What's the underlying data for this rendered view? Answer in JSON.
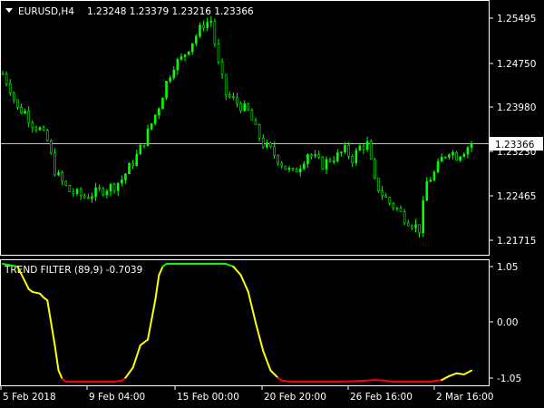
{
  "header": {
    "symbol_label": "EURUSD,H4",
    "ohlc": "1.23248 1.23379 1.23216 1.23366"
  },
  "price_axis": {
    "ticks": [
      "1.25495",
      "1.24750",
      "1.23980",
      "1.23230",
      "1.22465",
      "1.21715"
    ],
    "current_price_label": "1.23366"
  },
  "indicator": {
    "label": "TREND FILTER (89,9) -0.7039",
    "ticks": [
      "1.05",
      "0.00",
      "-1.05"
    ]
  },
  "time_axis": {
    "labels": [
      "5 Feb 2018",
      "9 Feb 04:00",
      "15 Feb 00:00",
      "20 Feb 20:00",
      "26 Feb 16:00",
      "2 Mar 16:00"
    ]
  },
  "colors": {
    "background": "#000000",
    "up_candle": "#00ff00",
    "grid_line": "#c0c0c0",
    "indicator_up": "#00ff00",
    "indicator_neutral": "#ffff00",
    "indicator_down": "#ff0000"
  },
  "chart_data": [
    {
      "type": "candlestick",
      "title": "EURUSD,H4",
      "price_ticks": [
        1.25495,
        1.2475,
        1.2398,
        1.2323,
        1.22465,
        1.21715
      ],
      "current_price": 1.23366,
      "close_path": [
        [
          0,
          1.2455
        ],
        [
          4,
          1.243
        ],
        [
          8,
          1.2395
        ],
        [
          12,
          1.239
        ],
        [
          16,
          1.237
        ],
        [
          20,
          1.236
        ],
        [
          24,
          1.234
        ],
        [
          28,
          1.229
        ],
        [
          32,
          1.227
        ],
        [
          36,
          1.2255
        ],
        [
          40,
          1.225
        ],
        [
          44,
          1.2245
        ],
        [
          48,
          1.225
        ],
        [
          52,
          1.2255
        ],
        [
          56,
          1.226
        ],
        [
          60,
          1.2265
        ],
        [
          64,
          1.2275
        ],
        [
          68,
          1.2295
        ],
        [
          72,
          1.2315
        ],
        [
          76,
          1.234
        ],
        [
          80,
          1.237
        ],
        [
          84,
          1.24
        ],
        [
          88,
          1.244
        ],
        [
          92,
          1.247
        ],
        [
          96,
          1.248
        ],
        [
          100,
          1.25
        ],
        [
          104,
          1.252
        ],
        [
          108,
          1.254
        ],
        [
          112,
          1.2545
        ],
        [
          116,
          1.247
        ],
        [
          120,
          1.242
        ],
        [
          124,
          1.241
        ],
        [
          128,
          1.24
        ],
        [
          132,
          1.239
        ],
        [
          136,
          1.236
        ],
        [
          140,
          1.2335
        ],
        [
          144,
          1.2325
        ],
        [
          148,
          1.231
        ],
        [
          152,
          1.2295
        ],
        [
          156,
          1.2285
        ],
        [
          160,
          1.23
        ],
        [
          164,
          1.232
        ],
        [
          168,
          1.231
        ],
        [
          172,
          1.23
        ],
        [
          176,
          1.231
        ],
        [
          180,
          1.2315
        ],
        [
          184,
          1.2325
        ],
        [
          188,
          1.231
        ],
        [
          192,
          1.233
        ],
        [
          196,
          1.2335
        ],
        [
          200,
          1.227
        ],
        [
          204,
          1.225
        ],
        [
          208,
          1.2235
        ],
        [
          212,
          1.2225
        ],
        [
          216,
          1.221
        ],
        [
          220,
          1.22
        ],
        [
          224,
          1.219
        ],
        [
          228,
          1.227
        ],
        [
          232,
          1.2285
        ],
        [
          236,
          1.231
        ],
        [
          240,
          1.2325
        ],
        [
          244,
          1.2315
        ],
        [
          248,
          1.2325
        ],
        [
          252,
          1.2337
        ]
      ]
    },
    {
      "type": "line",
      "title": "TREND FILTER (89,9)",
      "yticks": [
        1.05,
        0.0,
        -1.05
      ],
      "points": [
        [
          0,
          1.05
        ],
        [
          8,
          1.0
        ],
        [
          14,
          0.6
        ],
        [
          16,
          0.55
        ],
        [
          20,
          0.52
        ],
        [
          22,
          0.45
        ],
        [
          24,
          0.4
        ],
        [
          28,
          -0.4
        ],
        [
          30,
          -0.85
        ],
        [
          32,
          -1.0
        ],
        [
          34,
          -1.05
        ],
        [
          60,
          -1.05
        ],
        [
          64,
          -1.03
        ],
        [
          66,
          -0.98
        ],
        [
          70,
          -0.8
        ],
        [
          74,
          -0.4
        ],
        [
          78,
          -0.3
        ],
        [
          82,
          0.4
        ],
        [
          84,
          0.85
        ],
        [
          86,
          1.0
        ],
        [
          88,
          1.05
        ],
        [
          120,
          1.05
        ],
        [
          124,
          1.0
        ],
        [
          128,
          0.85
        ],
        [
          132,
          0.55
        ],
        [
          136,
          0.0
        ],
        [
          140,
          -0.5
        ],
        [
          144,
          -0.85
        ],
        [
          148,
          -0.98
        ],
        [
          150,
          -1.03
        ],
        [
          155,
          -1.05
        ],
        [
          180,
          -1.05
        ],
        [
          190,
          -1.04
        ],
        [
          200,
          -1.02
        ],
        [
          205,
          -1.03
        ],
        [
          210,
          -1.05
        ],
        [
          230,
          -1.05
        ],
        [
          236,
          -1.02
        ],
        [
          240,
          -0.95
        ],
        [
          244,
          -0.9
        ],
        [
          248,
          -0.92
        ],
        [
          252,
          -0.85
        ]
      ]
    }
  ]
}
